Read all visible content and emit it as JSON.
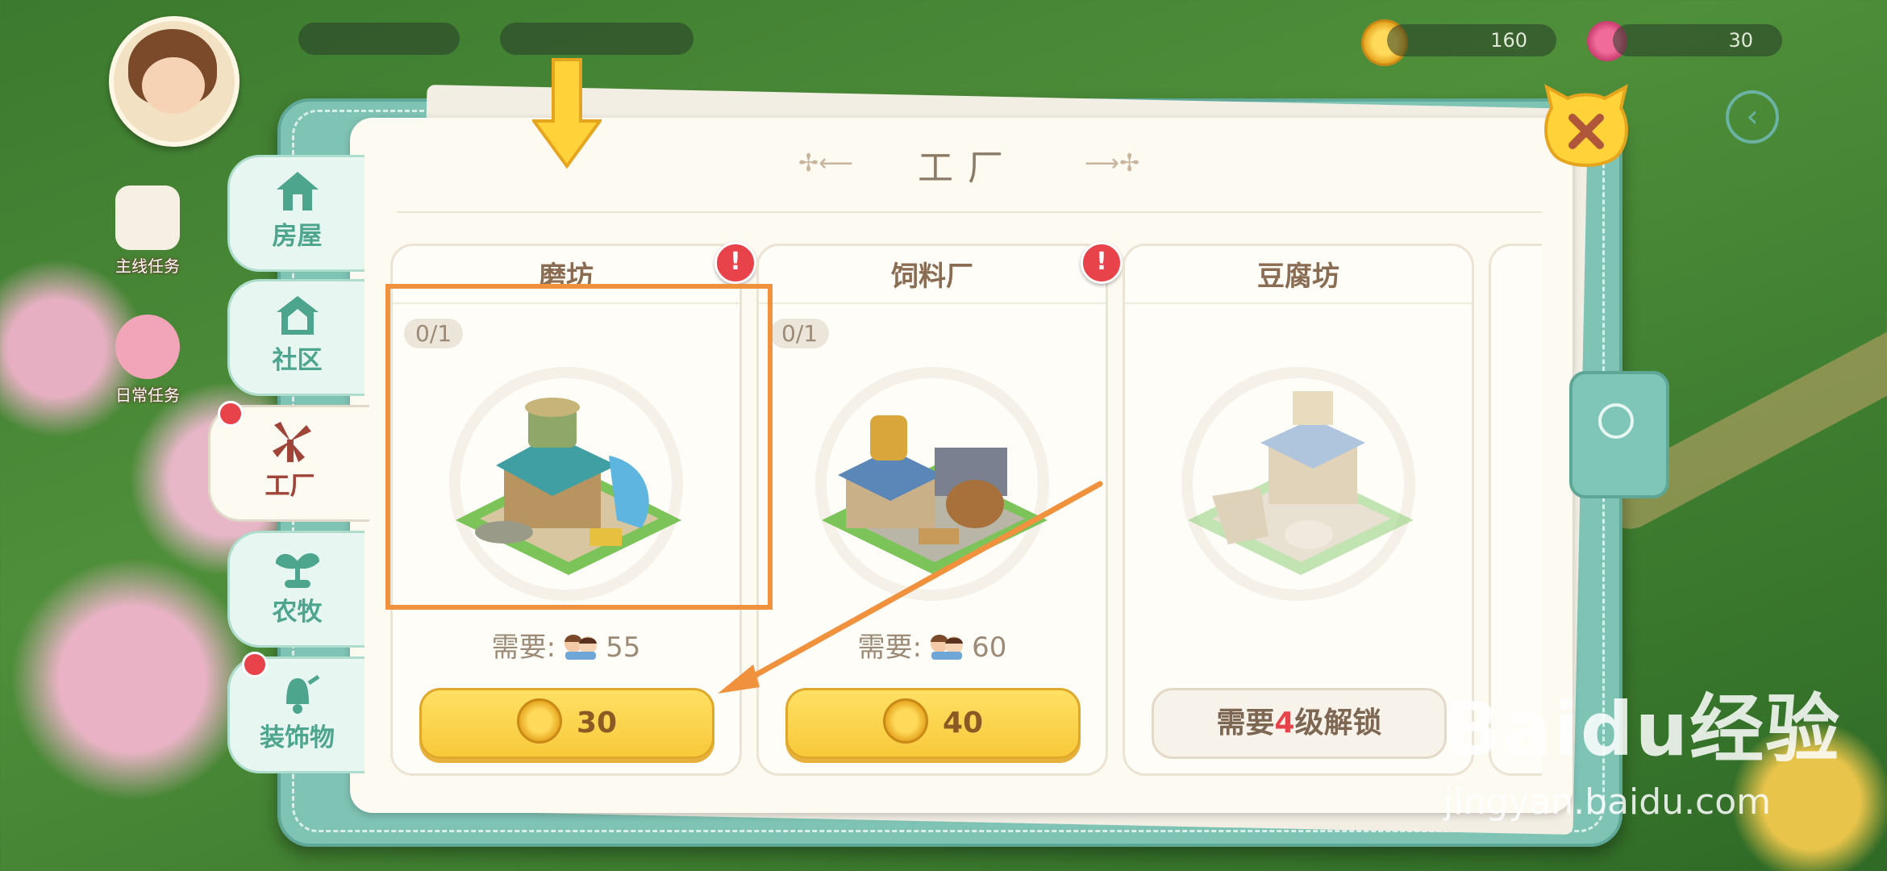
{
  "hud": {
    "coins": "160",
    "gems": "30",
    "task_bar": "",
    "side_tasks": [
      "主线任务",
      "日常任务"
    ]
  },
  "panel": {
    "title": "工厂",
    "tabs": [
      {
        "label": "房屋",
        "icon": "house-icon"
      },
      {
        "label": "社区",
        "icon": "community-icon"
      },
      {
        "label": "工厂",
        "icon": "windmill-icon"
      },
      {
        "label": "农牧",
        "icon": "sprout-icon"
      },
      {
        "label": "装饰物",
        "icon": "bell-icon"
      }
    ],
    "cards": [
      {
        "name": "磨坊",
        "count": "0/1",
        "need_label": "需要:",
        "need_value": "55",
        "price": "30",
        "alert": "!"
      },
      {
        "name": "饲料厂",
        "count": "0/1",
        "need_label": "需要:",
        "need_value": "60",
        "price": "40",
        "alert": "!"
      },
      {
        "name": "豆腐坊",
        "lock_prefix": "需要",
        "lock_level": "4",
        "lock_suffix": "级解锁"
      }
    ]
  },
  "watermark": {
    "brand": "Baidu经验",
    "url": "jingyan.baidu.com"
  },
  "colors": {
    "accent_teal": "#7fc3b5",
    "button_yellow": "#f8c93a",
    "alert_red": "#e8424a",
    "highlight_orange": "#f0913e"
  }
}
